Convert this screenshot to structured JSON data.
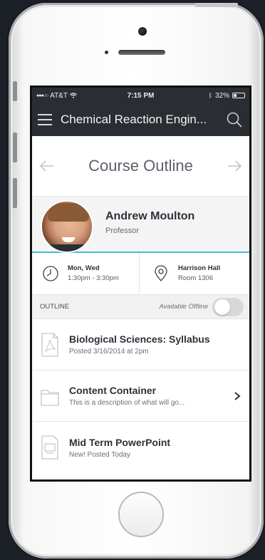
{
  "status": {
    "carrier": "AT&T",
    "time": "7:15 PM",
    "battery": "32%",
    "battery_level": 0.32
  },
  "nav": {
    "title": "Chemical Reaction Engin..."
  },
  "header": {
    "title": "Course Outline"
  },
  "instructor": {
    "name": "Andrew Moulton",
    "role": "Professor"
  },
  "schedule": {
    "days": "Mon, Wed",
    "hours": "1:30pm - 3:30pm"
  },
  "location": {
    "building": "Harrison Hall",
    "room": "Room 1306"
  },
  "outline_bar": {
    "label": "OUTLINE",
    "offline_label": "Available Offline",
    "offline_enabled": false
  },
  "items": [
    {
      "title": "Biological Sciences: Syllabus",
      "subtitle": "Posted 3/16/2014 at 2pm",
      "icon": "pdf-file-icon"
    },
    {
      "title": "Content Container",
      "subtitle": "This is a description of what will go...",
      "icon": "folder-icon"
    },
    {
      "title": "Mid Term PowerPoint",
      "subtitle": "New! Posted Today",
      "icon": "presentation-file-icon"
    }
  ]
}
